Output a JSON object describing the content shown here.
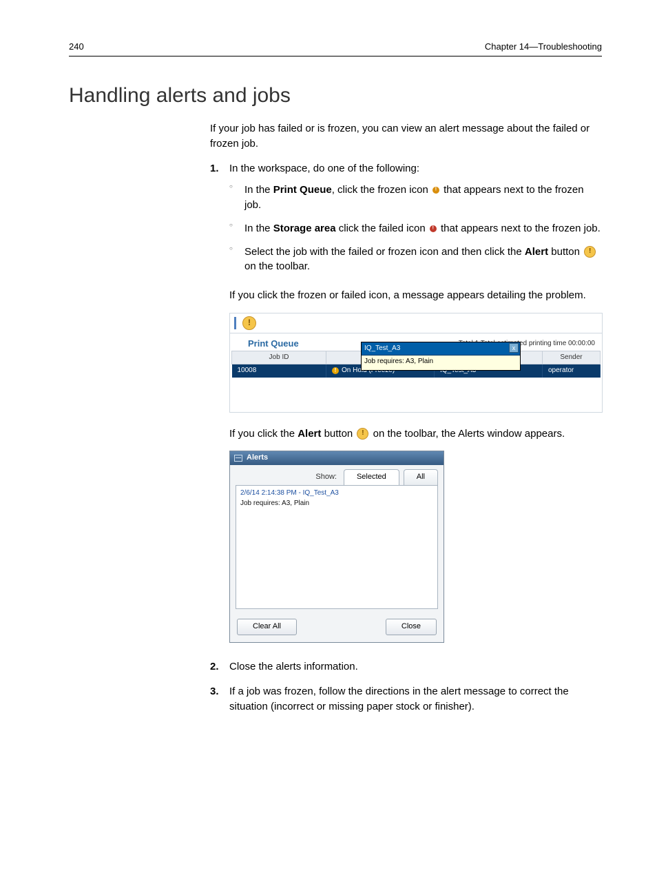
{
  "header": {
    "page_number": "240",
    "chapter": "Chapter 14—Troubleshooting"
  },
  "heading": "Handling alerts and jobs",
  "intro": "If your job has failed or is frozen, you can view an alert message about the failed or frozen job.",
  "step1": {
    "num": "1.",
    "text": "In the workspace, do one of the following:",
    "bullets": {
      "b1a": "In the ",
      "b1b": "Print Queue",
      "b1c": ", click the frozen icon ",
      "b1d": " that appears next to the frozen job.",
      "b2a": "In the ",
      "b2b": "Storage area",
      "b2c": " click the failed icon ",
      "b2d": " that appears next to the frozen job.",
      "b3a": "Select the job with the failed or frozen icon and then click the ",
      "b3b": "Alert",
      "b3c": " button ",
      "b3d": " on the toolbar."
    },
    "after1": "If you click the frozen or failed icon, a message appears detailing the problem.",
    "after2a": "If you click the ",
    "after2b": "Alert",
    "after2c": " button ",
    "after2d": " on the toolbar, the Alerts window appears."
  },
  "step2": {
    "num": "2.",
    "text": "Close the alerts information."
  },
  "step3": {
    "num": "3.",
    "text": "If a job was frozen, follow the directions in the alert message to correct the situation (incorrect or missing paper stock or finisher)."
  },
  "print_queue_fig": {
    "alert_icon_glyph": "!",
    "title": "Print Queue",
    "total": "Total 1   Total estimated printing time 00:00:00",
    "tooltip": {
      "title": "IQ_Test_A3",
      "close": "x",
      "body": "Job requires: A3, Plain"
    },
    "cols": {
      "c1": "Job ID",
      "c2": "",
      "c3": "",
      "c4": "Sender"
    },
    "row": {
      "jobid": "10008",
      "status_icon": "!",
      "status": "On Hold (Freeze)",
      "name": "IQ_Test_A3",
      "sender": "operator"
    }
  },
  "alerts_fig": {
    "title": "Alerts",
    "show_label": "Show:",
    "tab_selected": "Selected",
    "tab_all": "All",
    "item_title": "2/6/14 2:14:38 PM - IQ_Test_A3",
    "item_body": "Job requires: A3, Plain",
    "btn_clear": "Clear All",
    "btn_close": "Close"
  }
}
